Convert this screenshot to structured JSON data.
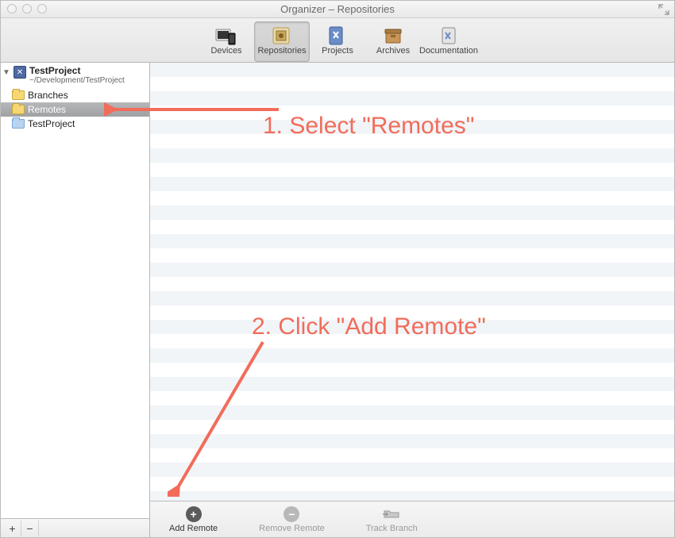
{
  "window": {
    "title": "Organizer – Repositories"
  },
  "toolbar": {
    "items": [
      {
        "label": "Devices"
      },
      {
        "label": "Repositories"
      },
      {
        "label": "Projects"
      },
      {
        "label": "Archives"
      },
      {
        "label": "Documentation"
      }
    ]
  },
  "sidebar": {
    "project": {
      "name": "TestProject",
      "path": "~/Development/TestProject"
    },
    "tree": [
      {
        "label": "Branches"
      },
      {
        "label": "Remotes"
      },
      {
        "label": "TestProject"
      }
    ]
  },
  "bottombar": {
    "add": "Add Remote",
    "remove": "Remove Remote",
    "track": "Track Branch"
  },
  "annotations": {
    "one": "1. Select \"Remotes\"",
    "two": "2. Click \"Add Remote\""
  },
  "sidebar_footer": {
    "add": "+",
    "remove": "−"
  }
}
